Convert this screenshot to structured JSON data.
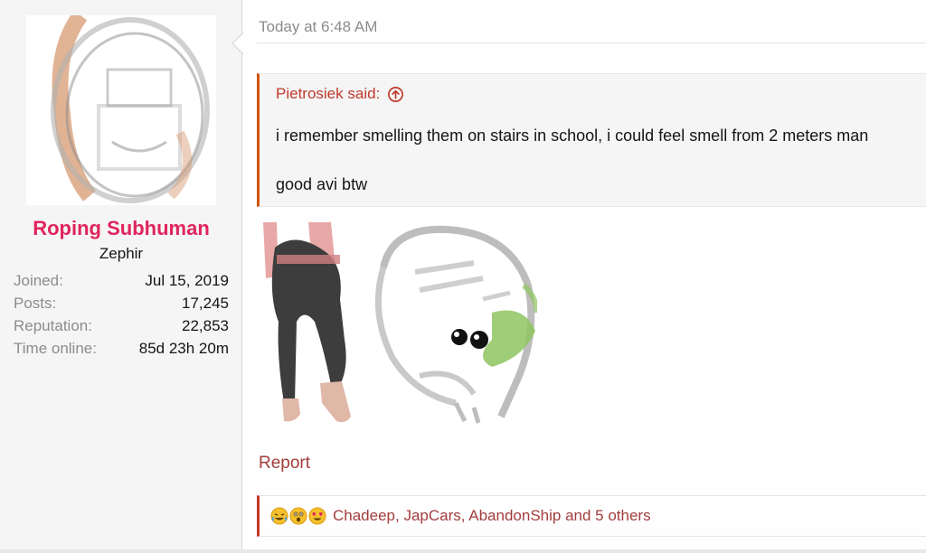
{
  "user": {
    "name": "Roping Subhuman",
    "title": "Zephir",
    "stats": [
      {
        "label": "Joined:",
        "value": "Jul 15, 2019"
      },
      {
        "label": "Posts:",
        "value": "17,245"
      },
      {
        "label": "Reputation:",
        "value": "22,853"
      },
      {
        "label": "Time online:",
        "value": "85d 23h 20m"
      }
    ]
  },
  "message": {
    "date": "Today at 6:48 AM",
    "quote": {
      "author": "Pietrosiek said:",
      "lines": [
        "i remember smelling them on stairs in school, i could feel smell from 2 meters man",
        "good avi btw"
      ]
    },
    "actions": {
      "report": "Report"
    },
    "reactions": {
      "emoji_icons": [
        "crying-laughing-emoji-icon",
        "astonished-emoji-icon",
        "heart-eyes-emoji-icon"
      ],
      "users_text": "Chadeep, JapCars, AbandonShip and 5 others"
    }
  },
  "colors": {
    "username": "#e0245e",
    "quote_bar": "#d35400",
    "link": "#a33d3d",
    "muted": "#8c8c8c"
  }
}
